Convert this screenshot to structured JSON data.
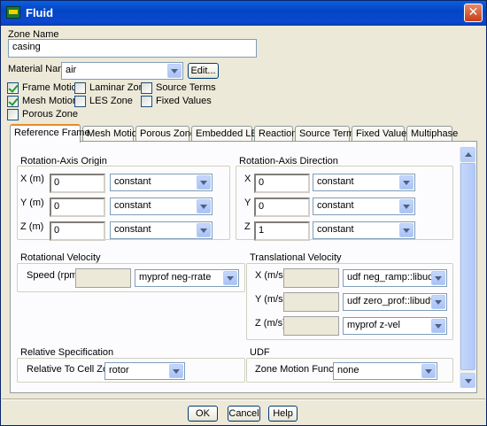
{
  "window": {
    "title": "Fluid",
    "close_symbol": "✕"
  },
  "zone": {
    "label": "Zone Name",
    "value": "casing"
  },
  "material": {
    "label": "Material Name",
    "value": "air",
    "edit_label": "Edit..."
  },
  "options": [
    {
      "label": "Frame Motion",
      "checked": true
    },
    {
      "label": "Laminar Zone",
      "checked": false
    },
    {
      "label": "Source Terms",
      "checked": false
    },
    {
      "label": "Mesh Motion",
      "checked": true
    },
    {
      "label": "LES Zone",
      "checked": false
    },
    {
      "label": "Fixed Values",
      "checked": false
    },
    {
      "label": "Porous Zone",
      "checked": false
    }
  ],
  "tabs": [
    "Reference Frame",
    "Mesh Motion",
    "Porous Zone",
    "Embedded LES",
    "Reaction",
    "Source Terms",
    "Fixed Values",
    "Multiphase"
  ],
  "active_tab": "Reference Frame",
  "axis_origin": {
    "title": "Rotation-Axis Origin",
    "rows": [
      {
        "label": "X (m)",
        "value": "0",
        "mode": "constant"
      },
      {
        "label": "Y (m)",
        "value": "0",
        "mode": "constant"
      },
      {
        "label": "Z (m)",
        "value": "0",
        "mode": "constant"
      }
    ]
  },
  "axis_direction": {
    "title": "Rotation-Axis Direction",
    "rows": [
      {
        "label": "X",
        "value": "0",
        "mode": "constant"
      },
      {
        "label": "Y",
        "value": "0",
        "mode": "constant"
      },
      {
        "label": "Z",
        "value": "1",
        "mode": "constant"
      }
    ]
  },
  "rotational": {
    "title": "Rotational Velocity",
    "speed_label": "Speed (rpm)",
    "speed_value": "",
    "profile": "myprof neg-rrate"
  },
  "translational": {
    "title": "Translational Velocity",
    "rows": [
      {
        "label": "X (m/s)",
        "value": "",
        "profile": "udf neg_ramp::libudf"
      },
      {
        "label": "Y (m/s)",
        "value": "",
        "profile": "udf zero_prof::libudf"
      },
      {
        "label": "Z (m/s)",
        "value": "",
        "profile": "myprof z-vel"
      }
    ]
  },
  "relative": {
    "title": "Relative Specification",
    "label": "Relative To Cell Zone",
    "value": "rotor"
  },
  "udf": {
    "title": "UDF",
    "label": "Zone Motion Function",
    "value": "none"
  },
  "footer": {
    "ok": "OK",
    "cancel": "Cancel",
    "help": "Help"
  },
  "colors": {
    "titlebar": "#0a49d0",
    "active_tab_accent": "#e68b2c",
    "check": "#21a121"
  }
}
